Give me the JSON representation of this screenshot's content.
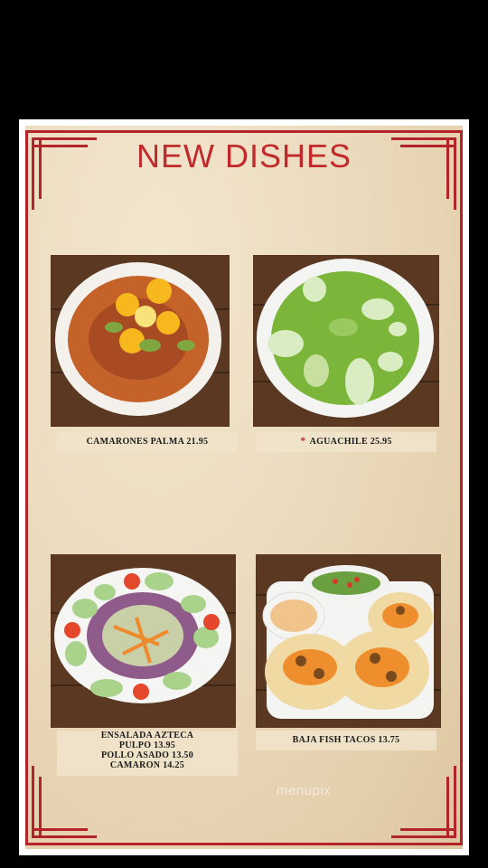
{
  "menu": {
    "title": "NEW DISHES",
    "items": [
      {
        "label": "CAMARONES PALMA 21.95"
      },
      {
        "marker": "*",
        "label": "AGUACHILE 25.95"
      },
      {
        "lines": [
          "ENSALADA AZTECA",
          "PULPO 13.95",
          "POLLO ASADO 13.50",
          "CAMARON 14.25"
        ]
      },
      {
        "label": "BAJA FISH TACOS 13.75"
      }
    ]
  },
  "watermark": "menupix",
  "colors": {
    "accent": "#c02a2a",
    "background": "#000000"
  }
}
